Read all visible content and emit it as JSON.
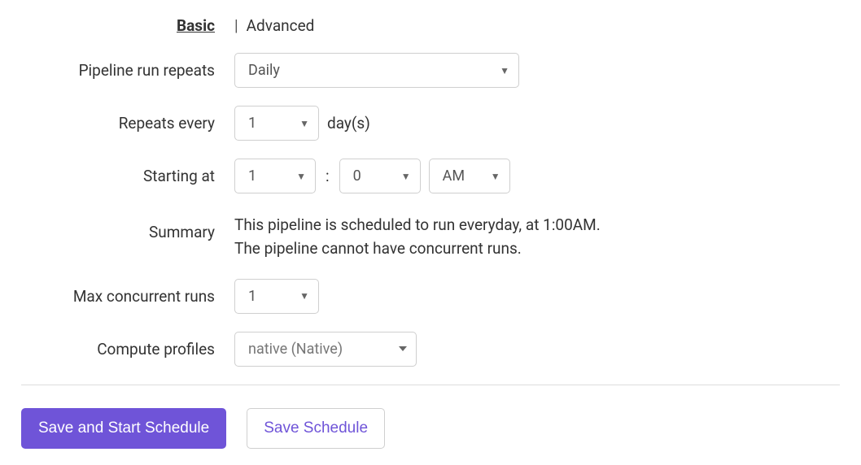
{
  "tabs": {
    "basic": "Basic",
    "separator": "|",
    "advanced": "Advanced"
  },
  "labels": {
    "pipeline_run_repeats": "Pipeline run repeats",
    "repeats_every": "Repeats every",
    "starting_at": "Starting at",
    "summary": "Summary",
    "max_concurrent": "Max concurrent runs",
    "compute_profiles": "Compute profiles"
  },
  "fields": {
    "pipeline_run_repeats": {
      "value": "Daily"
    },
    "repeats_every": {
      "value": "1",
      "unit": "day(s)"
    },
    "starting_at": {
      "hour": "1",
      "minute": "0",
      "ampm": "AM",
      "sep": ":"
    },
    "summary": {
      "line1": "This pipeline is scheduled to run everyday, at 1:00AM.",
      "line2": "The pipeline cannot have concurrent runs."
    },
    "max_concurrent": {
      "value": "1"
    },
    "compute_profiles": {
      "value": "native (Native)"
    }
  },
  "actions": {
    "save_and_start": "Save and Start Schedule",
    "save": "Save Schedule"
  }
}
